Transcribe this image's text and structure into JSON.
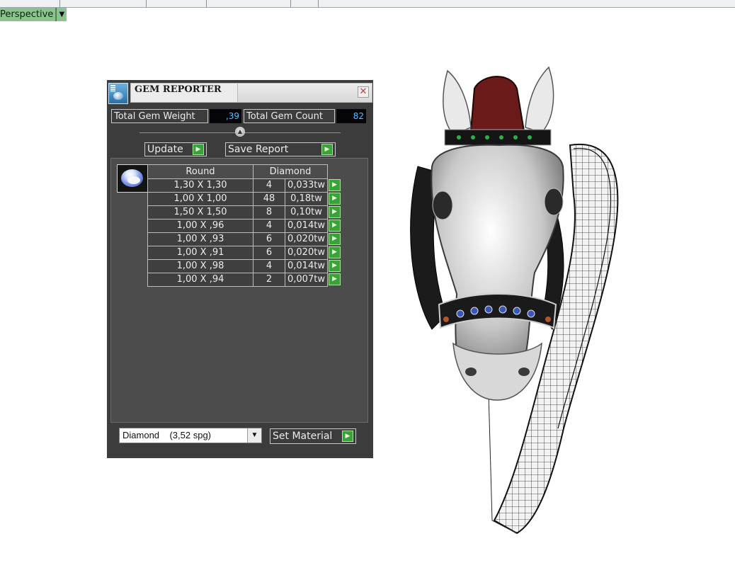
{
  "viewport": {
    "label": "Perspective"
  },
  "panel": {
    "title": "GEM REPORTER",
    "total_weight_label": "Total Gem Weight",
    "total_weight_value": ",39",
    "total_count_label": "Total Gem Count",
    "total_count_value": "82",
    "update_label": "Update",
    "save_report_label": "Save Report",
    "table": {
      "shape": "Round",
      "material": "Diamond",
      "rows": [
        {
          "size": "1,30 X 1,30",
          "count": "4",
          "weight": "0,033tw"
        },
        {
          "size": "1,00 X 1,00",
          "count": "48",
          "weight": "0,18tw"
        },
        {
          "size": "1,50 X 1,50",
          "count": "8",
          "weight": "0,10tw"
        },
        {
          "size": "1,00 X ,96",
          "count": "4",
          "weight": "0,014tw"
        },
        {
          "size": "1,00 X ,93",
          "count": "6",
          "weight": "0,020tw"
        },
        {
          "size": "1,00 X ,91",
          "count": "6",
          "weight": "0,020tw"
        },
        {
          "size": "1,00 X ,98",
          "count": "4",
          "weight": "0,014tw"
        },
        {
          "size": "1,00 X ,94",
          "count": "2",
          "weight": "0,007tw"
        }
      ]
    },
    "material_select": "Diamond    (3,52 spg)",
    "set_material_label": "Set Material"
  },
  "colors": {
    "panel_bg": "#3c3c3c",
    "accent_green": "#3aa335",
    "value_blue": "#59bfff",
    "view_label_bg": "#8bc48f"
  }
}
